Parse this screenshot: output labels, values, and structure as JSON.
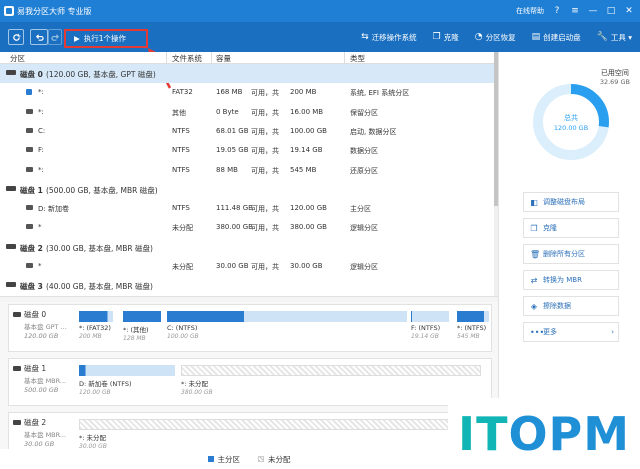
{
  "titlebar": {
    "title": "易我分区大师 专业版",
    "online_help": "在线帮助",
    "window_controls": [
      "?",
      "≡",
      "—",
      "□",
      "✕"
    ]
  },
  "toolbar": {
    "refresh_icon": "refresh-icon",
    "undo_icon": "undo-icon",
    "redo_icon": "redo-icon",
    "execute_label": "执行1个操作",
    "tools": [
      {
        "icon": "migrate-os-icon",
        "glyph": "⇆",
        "label": "迁移操作系统"
      },
      {
        "icon": "clone-icon",
        "glyph": "❐",
        "label": "克隆"
      },
      {
        "icon": "partition-recovery-icon",
        "glyph": "◔",
        "label": "分区恢复"
      },
      {
        "icon": "boot-disk-icon",
        "glyph": "▤",
        "label": "创建启动盘"
      },
      {
        "icon": "tools-icon",
        "glyph": "🔧",
        "label": "工具 ▾"
      }
    ]
  },
  "columns": [
    "分区",
    "文件系统",
    "容量",
    "类型"
  ],
  "rows": [
    {
      "kind": "disk",
      "name": "磁盘 0",
      "detail": "(120.00 GB, 基本盘, GPT 磁盘)",
      "selected": true
    },
    {
      "kind": "part",
      "icon": "sys",
      "name": "*:",
      "fs": "FAT32",
      "used": "168 MB",
      "free_label": "可用，共",
      "total": "200 MB",
      "type": "系统, EFI 系统分区"
    },
    {
      "kind": "part",
      "icon": "plain",
      "name": "*:",
      "fs": "其他",
      "used": "0 Byte",
      "free_label": "可用，共",
      "total": "16.00 MB",
      "type": "保留分区"
    },
    {
      "kind": "part",
      "icon": "plain",
      "name": "C:",
      "fs": "NTFS",
      "used": "68.01 GB",
      "free_label": "可用，共",
      "total": "100.00 GB",
      "type": "启动, 数据分区"
    },
    {
      "kind": "part",
      "icon": "plain",
      "name": "F:",
      "fs": "NTFS",
      "used": "19.05 GB",
      "free_label": "可用，共",
      "total": "19.14 GB",
      "type": "数据分区"
    },
    {
      "kind": "part",
      "icon": "plain",
      "name": "*:",
      "fs": "NTFS",
      "used": "88 MB",
      "free_label": "可用，共",
      "total": "545 MB",
      "type": "还原分区"
    },
    {
      "kind": "disk",
      "name": "磁盘 1",
      "detail": "(500.00 GB, 基本盘, MBR 磁盘)"
    },
    {
      "kind": "part",
      "icon": "plain",
      "name": "D: 新加卷",
      "fs": "NTFS",
      "used": "111.48 GB",
      "free_label": "可用，共",
      "total": "120.00 GB",
      "type": "主分区"
    },
    {
      "kind": "part",
      "icon": "plain",
      "name": "*",
      "fs": "未分配",
      "used": "380.00 GB",
      "free_label": "可用，共",
      "total": "380.00 GB",
      "type": "逻辑分区"
    },
    {
      "kind": "disk",
      "name": "磁盘 2",
      "detail": "(30.00 GB, 基本盘, MBR 磁盘)"
    },
    {
      "kind": "part",
      "icon": "plain",
      "name": "*",
      "fs": "未分配",
      "used": "30.00 GB",
      "free_label": "可用，共",
      "total": "30.00 GB",
      "type": "逻辑分区"
    },
    {
      "kind": "disk",
      "name": "磁盘 3",
      "detail": "(40.00 GB, 基本盘, MBR 磁盘)"
    }
  ],
  "diskmap": [
    {
      "name": "磁盘 0",
      "type": "基本盘 GPT ...",
      "size": "120.00 GB",
      "parts": [
        {
          "label": "*: (FAT32)",
          "size": "200 MB",
          "fill": 84,
          "style": "used"
        },
        {
          "label": "*: (其他)",
          "size": "128 MB",
          "fill": 100,
          "style": "used"
        },
        {
          "label": "C: (NTFS)",
          "size": "100.00 GB",
          "fill": 32,
          "style": "used"
        },
        {
          "label": "F: (NTFS)",
          "size": "19.14 GB",
          "fill": 1,
          "style": "used"
        },
        {
          "label": "*: (NTFS)",
          "size": "545 MB",
          "fill": 84,
          "style": "used"
        }
      ]
    },
    {
      "name": "磁盘 1",
      "type": "基本盘 MBR...",
      "size": "500.00 GB",
      "parts": [
        {
          "label": "D: 新加卷 (NTFS)",
          "size": "120.00 GB",
          "fill": 7,
          "style": "used"
        },
        {
          "label": "*: 未分配",
          "size": "380.00 GB",
          "fill": 0,
          "style": "un"
        }
      ]
    },
    {
      "name": "磁盘 2",
      "type": "基本盘 MBR...",
      "size": "30.00 GB",
      "parts": [
        {
          "label": "*: 未分配",
          "size": "30.00 GB",
          "fill": 0,
          "style": "un"
        }
      ]
    }
  ],
  "legend": [
    {
      "label": "主分区",
      "style": "main"
    },
    {
      "label": "未分配",
      "style": "un"
    }
  ],
  "summary": {
    "used_label": "已用空间",
    "used_value": "32.69 GB",
    "total_label": "总共",
    "total_value": "120.00 GB",
    "used_fraction": 0.2724,
    "accent": "#2a9ff0",
    "ring_bg": "#dbeefb"
  },
  "actions": [
    {
      "icon": "adjust-layout-icon",
      "glyph": "◧",
      "label": "调整磁盘布局"
    },
    {
      "icon": "clone-icon",
      "glyph": "❐",
      "label": "克隆"
    },
    {
      "icon": "delete-all-icon",
      "glyph": "🗑",
      "label": "删除所有分区"
    },
    {
      "icon": "convert-icon",
      "glyph": "⇄",
      "label": "转换为 MBR"
    },
    {
      "icon": "wipe-icon",
      "glyph": "◈",
      "label": "擦除数据"
    },
    {
      "icon": "more-icon",
      "glyph": "•••",
      "label": "更多",
      "chevron": "›"
    }
  ],
  "watermark": {
    "part1": "IT",
    "part2": "OPM"
  }
}
